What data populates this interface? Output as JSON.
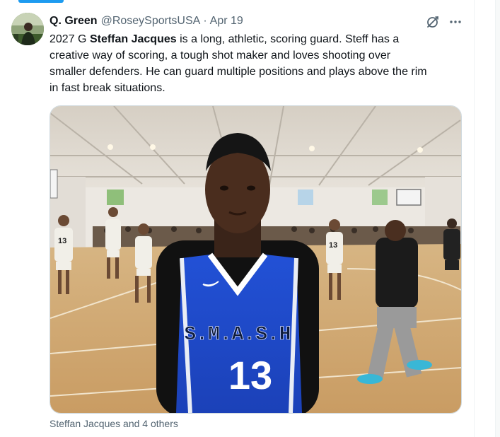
{
  "tweet": {
    "author_name": "Q. Green",
    "author_handle": "@RoseySportsUSA",
    "separator": "·",
    "date": "Apr 19",
    "text_parts": {
      "before": "2027 G ",
      "bold_name": "Steffan Jacques",
      "after": " is a long, athletic, scoring guard. Steff has a\ncreative way of scoring,  a tough shot maker and loves shooting over\nsmaller defenders. He can guard multiple positions and plays above the rim\nin fast break situations."
    },
    "media_tags": "Steffan Jacques and 4 others"
  },
  "photo": {
    "jersey_text": "S.M.A.S.H",
    "jersey_number": "13",
    "bg_player_numbers": [
      "13",
      "13"
    ]
  },
  "colors": {
    "accent": "#1d9bf0",
    "text_primary": "#0f1419",
    "text_secondary": "#536471",
    "jersey_blue": "#1c46c9"
  },
  "icons": {
    "grok": "grok-icon",
    "more": "more-icon"
  }
}
